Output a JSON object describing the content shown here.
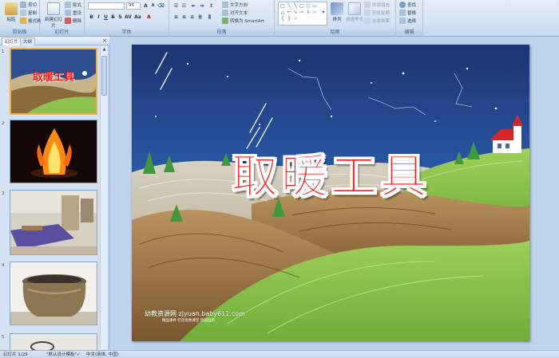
{
  "ribbon": {
    "clipboard": {
      "label": "剪贴板",
      "paste": "粘贴",
      "cut": "剪切",
      "copy": "复制",
      "format_painter": "格式刷"
    },
    "slides": {
      "label": "幻灯片",
      "new_slide": "新建幻灯片",
      "layout": "版式",
      "reset": "重设",
      "delete": "删除"
    },
    "font": {
      "label": "字体",
      "font_name": "",
      "font_size": "96"
    },
    "paragraph": {
      "label": "段落",
      "text_direction": "文字方向",
      "align_text": "对齐文本",
      "convert_smartart": "转换为 SmartArt"
    },
    "drawing": {
      "label": "绘图",
      "arrange": "排列",
      "quick_styles": "快速样式",
      "shape_fill": "形状填充",
      "shape_outline": "形状轮廓",
      "shape_effects": "形状效果"
    },
    "editing": {
      "label": "编辑",
      "find": "查找",
      "replace": "替换",
      "select": "选择"
    }
  },
  "panel": {
    "tab_slides": "幻灯片",
    "tab_outline": "大纲",
    "close": "×",
    "slide_numbers": [
      "1",
      "2",
      "3",
      "4",
      "5"
    ]
  },
  "slide": {
    "title": "取暖工具",
    "watermark": "幼教资源网 zjyuan.baby611.com",
    "watermark_sub": "精品课件 打造优秀课堂 欢迎选用"
  },
  "status": {
    "slide_info": "幻灯片 1/29",
    "theme": "\"默认设计模板\"",
    "language": "中文(简体, 中国)"
  },
  "colors": {
    "title_red": "#ff1515",
    "ribbon_bg": "#dbe6f4",
    "selected_thumb": "#f0b040"
  }
}
